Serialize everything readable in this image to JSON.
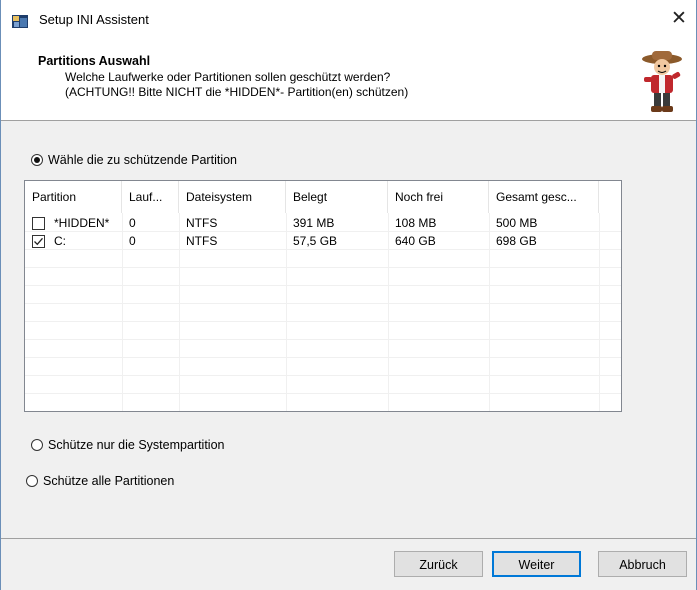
{
  "window": {
    "title": "Setup INI Assistent"
  },
  "header": {
    "title": "Partitions Auswahl",
    "line1": "Welche Laufwerke oder Partitionen sollen geschützt werden?",
    "line2": "(ACHTUNG!! Bitte NICHT die *HIDDEN*- Partition(en) schützen)"
  },
  "options": {
    "select_partition": "Wähle die zu schützende Partition",
    "system_only": "Schütze nur die Systempartition",
    "all_partitions": "Schütze alle Partitionen"
  },
  "table": {
    "columns": [
      "Partition",
      "Lauf...",
      "Dateisystem",
      "Belegt",
      "Noch frei",
      "Gesamt gesc..."
    ],
    "rows": [
      {
        "checked": false,
        "partition": "*HIDDEN*",
        "drive": "0",
        "fs": "NTFS",
        "used": "391 MB",
        "free": "108 MB",
        "total": "500 MB"
      },
      {
        "checked": true,
        "partition": "C:",
        "drive": "0",
        "fs": "NTFS",
        "used": "57,5 GB",
        "free": "640 GB",
        "total": "698 GB"
      }
    ]
  },
  "buttons": {
    "back": "Zurück",
    "next": "Weiter",
    "cancel": "Abbruch"
  },
  "colors": {
    "accent": "#0078d7",
    "window_border": "#6b8fb8"
  }
}
